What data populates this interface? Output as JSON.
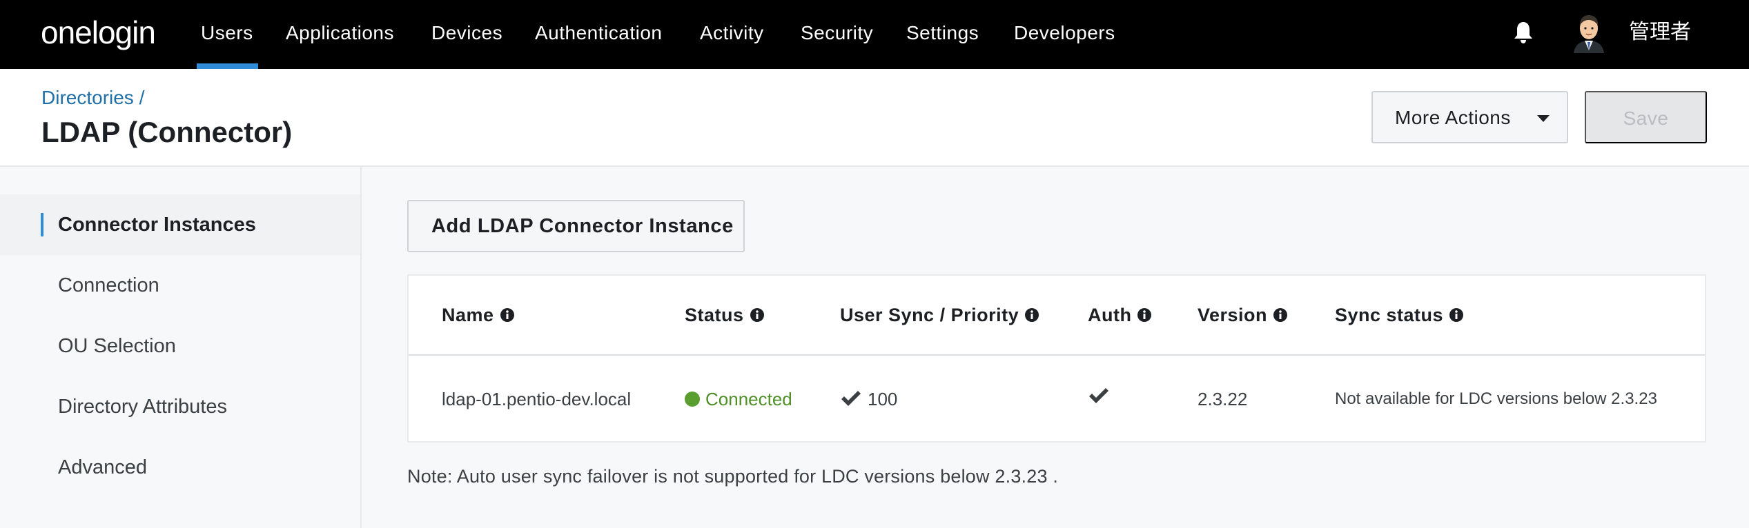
{
  "topnav": {
    "logo": "onelogin",
    "items": [
      "Users",
      "Applications",
      "Devices",
      "Authentication",
      "Activity",
      "Security",
      "Settings",
      "Developers"
    ],
    "active": "Users",
    "username": "管理者"
  },
  "header": {
    "breadcrumb": "Directories /",
    "title": "LDAP (Connector)",
    "more_actions_label": "More Actions",
    "save_label": "Save"
  },
  "sidebar": {
    "items": [
      {
        "label": "Connector Instances",
        "active": true
      },
      {
        "label": "Connection"
      },
      {
        "label": "OU Selection"
      },
      {
        "label": "Directory Attributes"
      },
      {
        "label": "Advanced"
      }
    ]
  },
  "main": {
    "add_button_label": "Add LDAP Connector Instance",
    "table": {
      "columns": [
        "Name",
        "Status",
        "User Sync / Priority",
        "Auth",
        "Version",
        "Sync status"
      ],
      "rows": [
        {
          "name": "ldap-01.pentio-dev.local",
          "status": "Connected",
          "user_sync_priority": "100",
          "auth": "check",
          "version": "2.3.22",
          "sync_status": "Not available for LDC versions below 2.3.23"
        }
      ]
    },
    "note": "Note: Auto user sync failover is not supported for LDC versions below 2.3.23 ."
  },
  "colors": {
    "nav_bg": "#000000",
    "accent": "#2f8cd8",
    "link": "#1f6fa8",
    "connected": "#5a9e2f"
  }
}
